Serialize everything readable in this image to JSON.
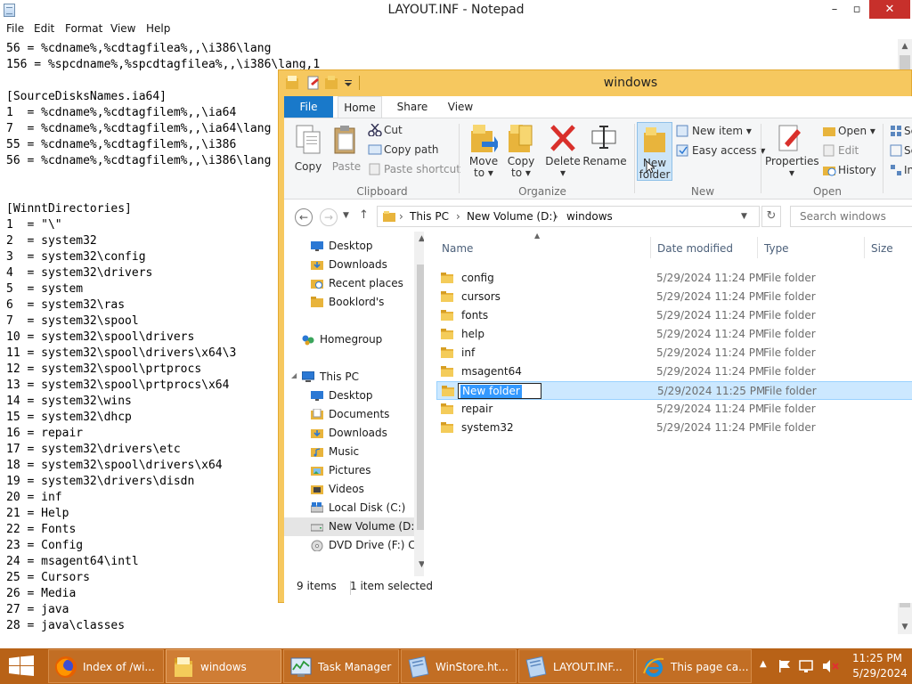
{
  "notepad": {
    "title": "LAYOUT.INF - Notepad",
    "window_buttons": {
      "minimize": "–",
      "maximize": "▫",
      "close": "✕"
    },
    "menu": [
      "File",
      "Edit",
      "Format",
      "View",
      "Help"
    ],
    "lines": [
      "56 = %cdname%,%cdtagfilea%,,\\i386\\lang",
      "156 = %spcdname%,%spcdtagfilea%,,\\i386\\lang,1",
      "",
      "[SourceDisksNames.ia64]",
      "1  = %cdname%,%cdtagfilem%,,\\ia64",
      "7  = %cdname%,%cdtagfilem%,,\\ia64\\lang",
      "55 = %cdname%,%cdtagfilem%,,\\i386",
      "56 = %cdname%,%cdtagfilem%,,\\i386\\lang",
      "",
      "",
      "[WinntDirectories]",
      "1  = \"\\\"",
      "2  = system32",
      "3  = system32\\config",
      "4  = system32\\drivers",
      "5  = system",
      "6  = system32\\ras",
      "7  = system32\\spool",
      "10 = system32\\spool\\drivers",
      "11 = system32\\spool\\drivers\\x64\\3",
      "12 = system32\\spool\\prtprocs",
      "13 = system32\\spool\\prtprocs\\x64",
      "14 = system32\\wins",
      "15 = system32\\dhcp",
      "16 = repair",
      "17 = system32\\drivers\\etc",
      "18 = system32\\spool\\drivers\\x64",
      "19 = system32\\drivers\\disdn",
      "20 = inf",
      "21 = Help",
      "22 = Fonts",
      "23 = Config",
      "24 = msagent64\\intl",
      "25 = Cursors",
      "26 = Media",
      "27 = java",
      "28 = java\\classes"
    ]
  },
  "explorer": {
    "title": "windows",
    "ribbon_tabs": [
      "File",
      "Home",
      "Share",
      "View"
    ],
    "ribbon": {
      "copy": "Copy",
      "paste": "Paste",
      "cut": "Cut",
      "copy_path": "Copy path",
      "paste_shortcut": "Paste shortcut",
      "move_to": "Move",
      "move_to_2": "to ▾",
      "copy_to": "Copy",
      "copy_to_2": "to ▾",
      "delete": "Delete",
      "delete_2": "▾",
      "rename": "Rename",
      "new_folder": "New",
      "new_folder_2": "folder",
      "new_item": "New item ▾",
      "easy_access": "Easy access ▾",
      "properties": "Properties",
      "properties_2": "▾",
      "open": "Open ▾",
      "edit": "Edit",
      "history": "History",
      "select_1": "Sel",
      "select_2": "Sel",
      "select_3": "Inv",
      "groups": [
        "Clipboard",
        "Organize",
        "New",
        "Open"
      ]
    },
    "address": {
      "segments": [
        "This PC",
        "New Volume (D:)",
        "windows"
      ],
      "search_placeholder": "Search windows"
    },
    "nav": [
      {
        "label": "Desktop",
        "icon": "desktop-icon",
        "selected": false
      },
      {
        "label": "Downloads",
        "icon": "downloads-icon",
        "selected": false
      },
      {
        "label": "Recent places",
        "icon": "recent-places-icon",
        "selected": false
      },
      {
        "label": "Booklord's",
        "icon": "folder-icon",
        "selected": false
      },
      {
        "label": "Homegroup",
        "icon": "homegroup-icon",
        "selected": false
      },
      {
        "label": "This PC",
        "icon": "this-pc-icon",
        "selected": false
      },
      {
        "label": "Desktop",
        "icon": "desktop-icon",
        "selected": false
      },
      {
        "label": "Documents",
        "icon": "documents-icon",
        "selected": false
      },
      {
        "label": "Downloads",
        "icon": "downloads-icon",
        "selected": false
      },
      {
        "label": "Music",
        "icon": "music-icon",
        "selected": false
      },
      {
        "label": "Pictures",
        "icon": "pictures-icon",
        "selected": false
      },
      {
        "label": "Videos",
        "icon": "videos-icon",
        "selected": false
      },
      {
        "label": "Local Disk (C:)",
        "icon": "local-disk-icon",
        "selected": false
      },
      {
        "label": "New Volume (D:)",
        "icon": "drive-icon",
        "selected": true
      },
      {
        "label": "DVD Drive (F:) CD",
        "icon": "dvd-drive-icon",
        "selected": false
      }
    ],
    "columns": {
      "name": "Name",
      "date": "Date modified",
      "type": "Type",
      "size": "Size"
    },
    "files": [
      {
        "name": "config",
        "date": "5/29/2024 11:24 PM",
        "type": "File folder"
      },
      {
        "name": "cursors",
        "date": "5/29/2024 11:24 PM",
        "type": "File folder"
      },
      {
        "name": "fonts",
        "date": "5/29/2024 11:24 PM",
        "type": "File folder"
      },
      {
        "name": "help",
        "date": "5/29/2024 11:24 PM",
        "type": "File folder"
      },
      {
        "name": "inf",
        "date": "5/29/2024 11:24 PM",
        "type": "File folder"
      },
      {
        "name": "msagent64",
        "date": "5/29/2024 11:24 PM",
        "type": "File folder"
      },
      {
        "name": "New folder",
        "date": "5/29/2024 11:25 PM",
        "type": "File folder",
        "editing": true
      },
      {
        "name": "repair",
        "date": "5/29/2024 11:24 PM",
        "type": "File folder"
      },
      {
        "name": "system32",
        "date": "5/29/2024 11:24 PM",
        "type": "File folder"
      }
    ],
    "status": {
      "count": "9 items",
      "selected": "1 item selected"
    }
  },
  "taskbar": {
    "buttons": [
      {
        "label": "Index of /wi...",
        "icon": "firefox-icon",
        "state": "open"
      },
      {
        "label": "windows",
        "icon": "folder-icon",
        "state": "active"
      },
      {
        "label": "Task Manager",
        "icon": "task-manager-icon",
        "state": "open"
      },
      {
        "label": "WinStore.ht...",
        "icon": "notepad-icon",
        "state": "open"
      },
      {
        "label": "LAYOUT.INF...",
        "icon": "notepad-icon",
        "state": "open"
      },
      {
        "label": "This page ca...",
        "icon": "internet-explorer-icon",
        "state": "open"
      }
    ],
    "time": "11:25 PM",
    "date": "5/29/2024"
  },
  "colors": {
    "explorer_frame": "#f6c85f",
    "taskbar": "#b86217",
    "selection": "#cce8ff",
    "file_tab": "#1979ca"
  }
}
